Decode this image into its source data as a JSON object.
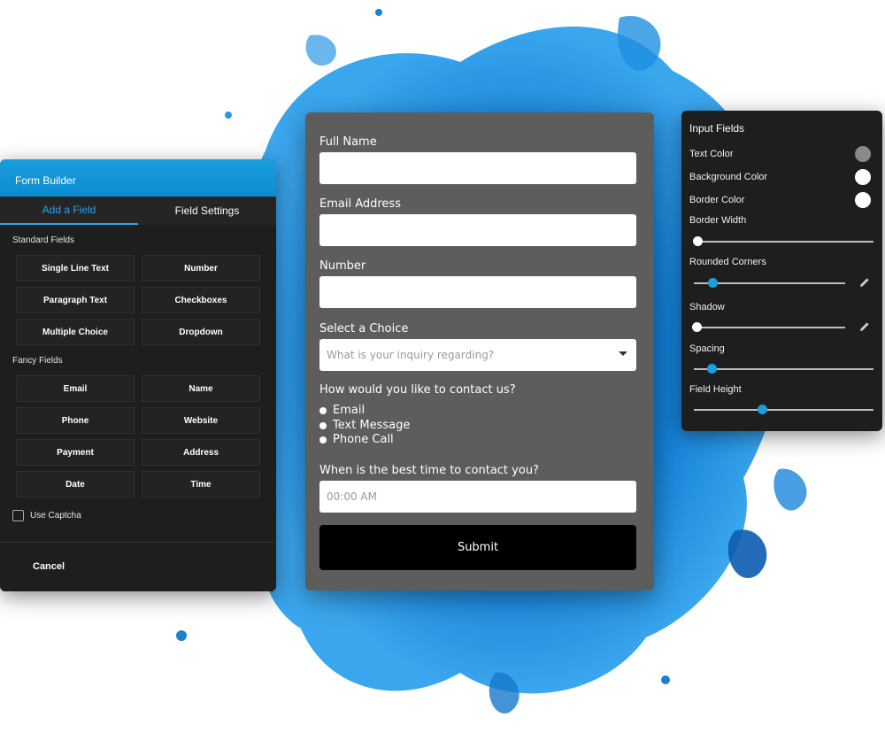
{
  "builder": {
    "title": "Form Builder",
    "tabs": [
      {
        "label": "Add a Field",
        "active": true
      },
      {
        "label": "Field Settings",
        "active": false
      }
    ],
    "standard_label": "Standard Fields",
    "standard_fields": [
      "Single Line Text",
      "Number",
      "Paragraph Text",
      "Checkboxes",
      "Multiple Choice",
      "Dropdown"
    ],
    "fancy_label": "Fancy Fields",
    "fancy_fields": [
      "Email",
      "Name",
      "Phone",
      "Website",
      "Payment",
      "Address",
      "Date",
      "Time"
    ],
    "captcha_label": "Use Captcha",
    "captcha_checked": false,
    "cancel_label": "Cancel",
    "accent_color": "#1a9ee0"
  },
  "preview": {
    "full_name_label": "Full Name",
    "full_name_value": "",
    "email_label": "Email Address",
    "email_value": "",
    "number_label": "Number",
    "number_value": "",
    "select_label": "Select a Choice",
    "select_placeholder": "What is your inquiry regarding?",
    "contact_question": "How would you like to contact us?",
    "contact_options": [
      "Email",
      "Text Message",
      "Phone Call"
    ],
    "time_question": "When is the best time to contact you?",
    "time_placeholder": "00:00 AM",
    "submit_label": "Submit"
  },
  "settings": {
    "title": "Input Fields",
    "text_color_label": "Text Color",
    "text_color": "#8a8a8a",
    "background_color_label": "Background Color",
    "background_color": "#ffffff",
    "border_color_label": "Border Color",
    "border_color": "#ffffff",
    "border_width_label": "Border Width",
    "border_width_level": 0.02,
    "rounded_corners_label": "Rounded Corners",
    "rounded_corners_level": 0.12,
    "shadow_label": "Shadow",
    "shadow_level": 0.02,
    "spacing_label": "Spacing",
    "spacing_level": 0.1,
    "field_height_label": "Field Height",
    "field_height_level": 0.38,
    "slider_accent": "#1a9ee0"
  }
}
